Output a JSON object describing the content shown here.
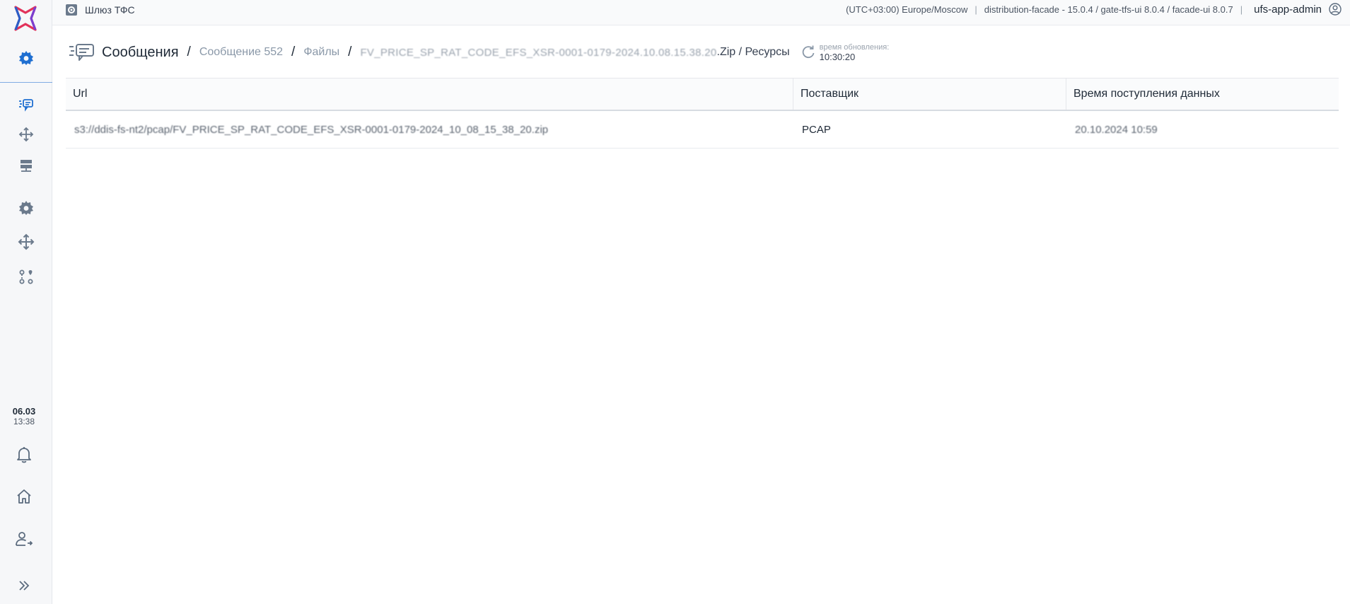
{
  "topbar": {
    "app_name": "Шлюз ТФС",
    "timezone": "(UTC+03:00) Europe/Moscow",
    "versions": "distribution-facade - 15.0.4 / gate-tfs-ui 8.0.4 / facade-ui 8.0.7",
    "separator": "|",
    "user": "ufs-app-admin"
  },
  "sidebar": {
    "date": "06.03",
    "time": "13:38"
  },
  "breadcrumb": {
    "root": "Сообщения",
    "separator": "/",
    "message": "Сообщение 552",
    "files": "Файлы",
    "file_name": "FV_PRICE_SP_RAT_CODE_EFS_XSR-0001-0179-2024.10.08.15.38.20",
    "file_tail": ".Zip / Ресурсы"
  },
  "refresh": {
    "label": "время обновления:",
    "time": "10:30:20"
  },
  "table": {
    "columns": [
      "Url",
      "Поставщик",
      "Время поступления данных"
    ],
    "rows": [
      {
        "url": "s3://ddis-fs-nt2/pcap/FV_PRICE_SP_RAT_CODE_EFS_XSR-0001-0179-2024_10_08_15_38_20.zip",
        "provider": "PCAP",
        "received": "20.10.2024 10:59"
      }
    ]
  },
  "colors": {
    "accent": "#1f6fd1",
    "logo_red": "#e2325a",
    "logo_blue": "#2a5fc9"
  }
}
